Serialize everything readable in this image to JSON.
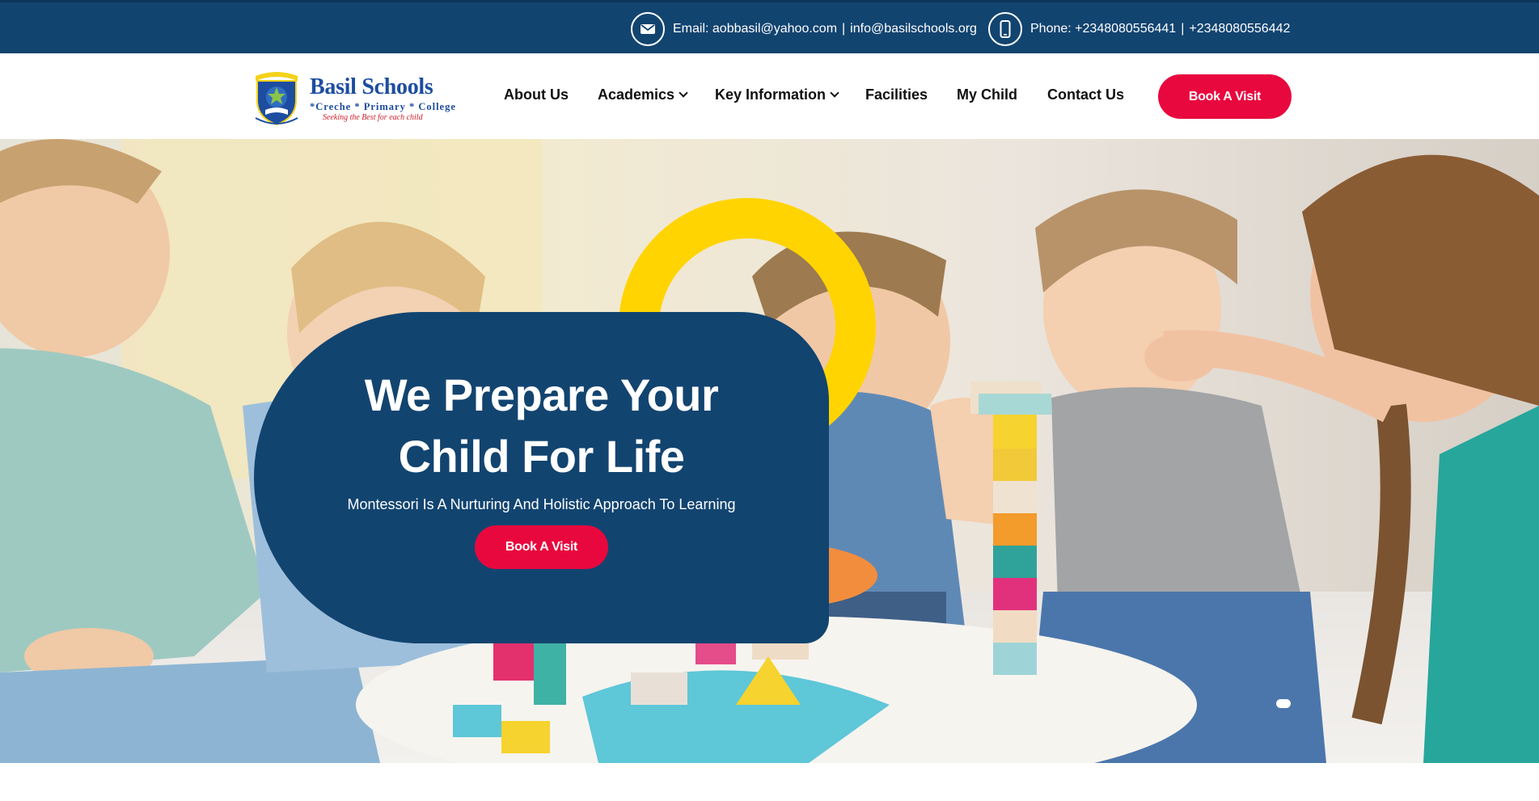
{
  "topbar": {
    "email_label": "Email:",
    "email_primary": "aobbasil@yahoo.com",
    "email_secondary": "info@basilschools.org",
    "phone_label": "Phone:",
    "phone_primary": "+2348080556441",
    "phone_secondary": "+2348080556442",
    "separator": "|",
    "background": "#124470"
  },
  "logo": {
    "name": "Basil Schools",
    "subtitle": "*Creche * Primary * College",
    "motto": "Seeking the Best for each child",
    "crest_text": "BASIL SCHOOLS"
  },
  "nav": {
    "items": [
      {
        "label": "About Us",
        "dropdown": false
      },
      {
        "label": "Academics",
        "dropdown": true
      },
      {
        "label": "Key Information",
        "dropdown": true
      },
      {
        "label": "Facilities",
        "dropdown": false
      },
      {
        "label": "My Child",
        "dropdown": false
      },
      {
        "label": "Contact Us",
        "dropdown": false
      }
    ],
    "cta_label": "Book A Visit"
  },
  "hero": {
    "title_line1": "We Prepare Your",
    "title_line2": "Child For Life",
    "subtitle": "Montessori Is A Nurturing And Holistic Approach To Learning",
    "cta_label": "Book A Visit",
    "card_color": "#124470",
    "ring_color": "#ffd400"
  },
  "colors": {
    "accent": "#e8083e",
    "brand": "#124470"
  },
  "icons": {
    "email": "envelope-icon",
    "phone": "mobile-phone-icon",
    "dropdown": "chevron-down-icon"
  },
  "slider": {
    "active_index": 1,
    "total": 1
  }
}
